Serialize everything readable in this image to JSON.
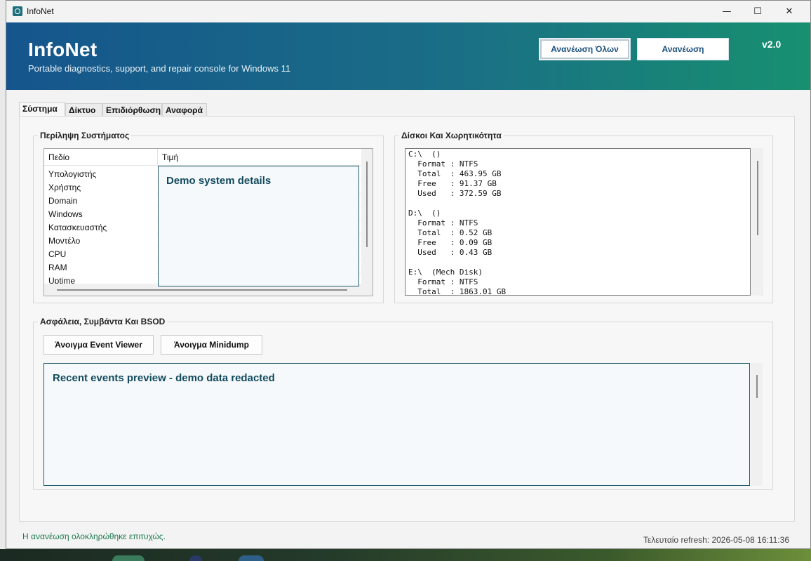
{
  "window": {
    "title": "InfoNet",
    "controls": {
      "minimize": "—",
      "maximize": "☐",
      "close": "✕"
    }
  },
  "header": {
    "app_name": "InfoNet",
    "subtitle": "Portable diagnostics, support, and repair console for Windows 11",
    "version": "v2.0",
    "refresh_all_label": "Ανανέωση Όλων",
    "refresh_label": "Ανανέωση",
    "colors": {
      "gradient_start": "#15558c",
      "gradient_end": "#179070"
    }
  },
  "tabs": [
    "Σύστημα",
    "Δίκτυο",
    "Επιδιόρθωση",
    "Αναφορά"
  ],
  "system_summary": {
    "title": "Περίληψη Συστήματος",
    "columns": [
      "Πεδίο",
      "Τιμή"
    ],
    "rows": [
      "Υπολογιστής",
      "Χρήστης",
      "Domain",
      "Windows",
      "Κατασκευαστής",
      "Μοντέλο",
      "CPU",
      "RAM",
      "Uptime"
    ],
    "overlay_text": "Demo system details"
  },
  "disks": {
    "title": "Δίσκοι Και Χωρητικότητα",
    "text": "C:\\  ()\n  Format : NTFS\n  Total  : 463.95 GB\n  Free   : 91.37 GB\n  Used   : 372.59 GB\n\nD:\\  ()\n  Format : NTFS\n  Total  : 0.52 GB\n  Free   : 0.09 GB\n  Used   : 0.43 GB\n\nE:\\  (Mech Disk)\n  Format : NTFS\n  Total  : 1863.01 GB"
  },
  "security": {
    "title": "Ασφάλεια, Συμβάντα Και BSOD",
    "open_event_viewer_label": "Άνοιγμα Event Viewer",
    "open_minidump_label": "Άνοιγμα Minidump",
    "events_preview": "Recent events preview - demo data redacted"
  },
  "status": {
    "message": "Η ανανέωση ολοκληρώθηκε επιτυχώς.",
    "last_refresh": "Τελευταίο refresh: 2026-05-08 16:11:36"
  }
}
